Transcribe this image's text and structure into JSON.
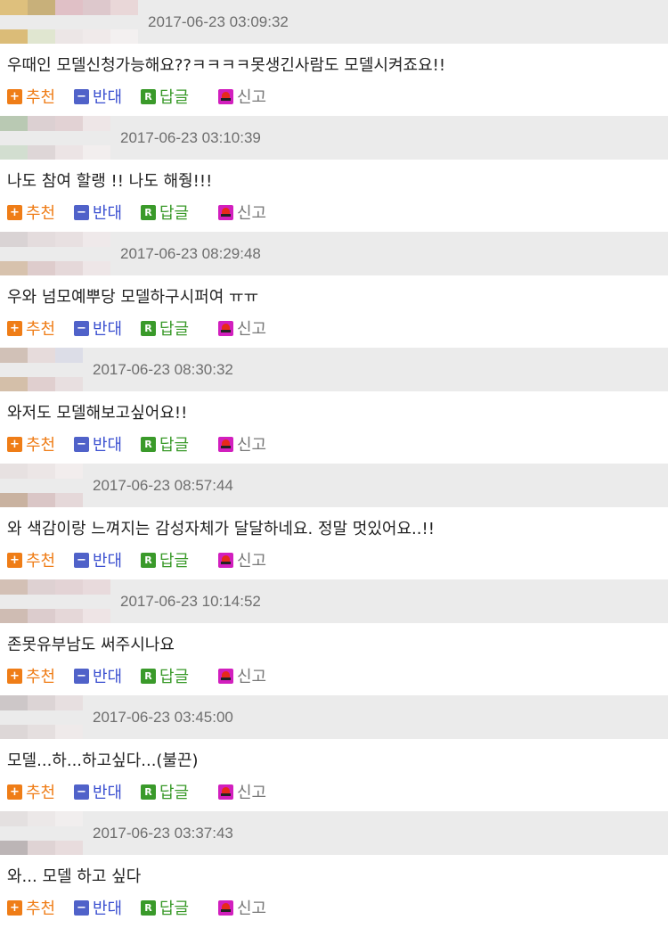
{
  "action_labels": {
    "up": "추천",
    "down": "반대",
    "reply": "답글",
    "report": "신고"
  },
  "action_icons": {
    "up": "plus-icon",
    "down": "minus-icon",
    "reply": "reply-r-icon",
    "report": "siren-icon"
  },
  "colors": {
    "header_bg": "#ebebeb",
    "up": "#ef7d17",
    "down": "#5062c9",
    "reply": "#3a9a2a",
    "report_icon": "#d21fbe",
    "text": "#222222",
    "date": "#6e6e6e"
  },
  "comments": [
    {
      "date": "2017-06-23 03:09:32",
      "text": "우때인 모델신청가능해요??ㅋㅋㅋㅋ못생긴사람도 모델시켜죠요!!",
      "avatar_colors": [
        "#dec07d",
        "#c8b07a",
        "#e0c0c6",
        "#ddc8cc",
        "#e9d7d8",
        "#dbbc78",
        "#e0e6d0",
        "#ece6e6",
        "#f0eaea",
        "#f3f0f0"
      ]
    },
    {
      "date": "2017-06-23 03:10:39",
      "text": "나도 참여 할랭 !! 나도 해줭!!!",
      "avatar_colors": [
        "#b9c9b3",
        "#dcd0d2",
        "#e2d2d4",
        "#eee6e7",
        "#d2ded0",
        "#ded6d7",
        "#ece4e5",
        "#f2eeee"
      ]
    },
    {
      "date": "2017-06-23 08:29:48",
      "text": "우와 넘모예뿌당 모델하구시퍼여 ㅠㅠ",
      "avatar_colors": [
        "#d9d3d4",
        "#e4dcdd",
        "#e8e0e1",
        "#efe9ea",
        "#d7c2ad",
        "#decccc",
        "#e5d8d9",
        "#eee6e7"
      ]
    },
    {
      "date": "2017-06-23 08:30:32",
      "text": "와저도 모델해보고싶어요!!",
      "avatar_colors": [
        "#d1c1b7",
        "#e6dbdb",
        "#dcdde7",
        "#d4bfa9",
        "#e0cfcf",
        "#e8dfe0",
        "#f1ecec"
      ]
    },
    {
      "date": "2017-06-23 08:57:44",
      "text": "와 색감이랑 느껴지는 감성자체가 달달하네요. 정말 멋있어요..!!",
      "avatar_colors": [
        "#e7e1e1",
        "#ece6e6",
        "#f2eded",
        "#c9b2a0",
        "#dac6c6",
        "#e5d8d9",
        "#f1ecec"
      ]
    },
    {
      "date": "2017-06-23 10:14:52",
      "text": "존못유부남도 써주시나요",
      "avatar_colors": [
        "#d3c0b5",
        "#ded1d2",
        "#e3d3d5",
        "#e8dadc",
        "#cfbcb3",
        "#dccccd",
        "#e5d7d8",
        "#eee4e5"
      ]
    },
    {
      "date": "2017-06-23 03:45:00",
      "text": "모델...하...하고싶다...(불끈)",
      "avatar_colors": [
        "#cdc7c8",
        "#dcd4d5",
        "#e7dfe0",
        "#ddd7d7",
        "#e5dfdf",
        "#efeaea",
        "#f3efef"
      ]
    },
    {
      "date": "2017-06-23 03:37:43",
      "text": "와... 모델 하고 싶다",
      "avatar_colors": [
        "#e4e0e0",
        "#ece8e8",
        "#f1eeee",
        "#bcb5b6",
        "#dfd3d4",
        "#e8dcdd",
        "#f0eaea"
      ]
    }
  ]
}
